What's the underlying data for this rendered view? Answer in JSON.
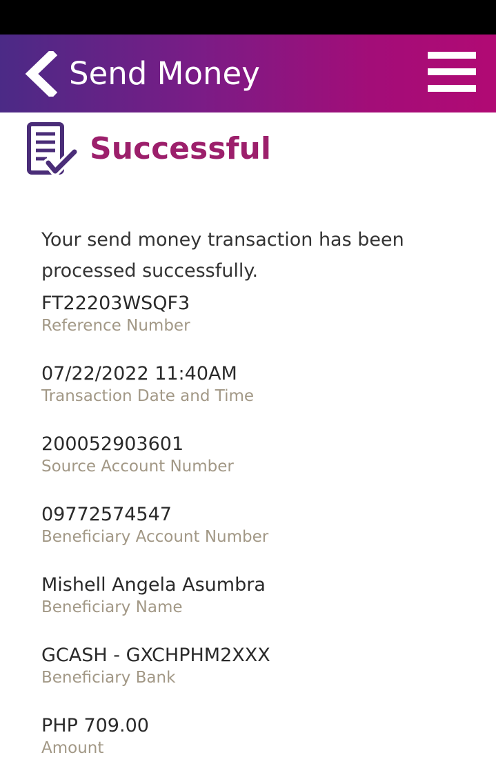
{
  "header": {
    "title": "Send Money",
    "back_icon": "chevron-left-icon",
    "menu_icon": "hamburger-menu-icon",
    "gradient": [
      "#4b2a86",
      "#b10a74"
    ]
  },
  "status": {
    "icon": "receipt-check-icon",
    "title": "Successful",
    "title_color": "#9c1f6b",
    "message": "Your send money transaction has been processed successfully."
  },
  "details": [
    {
      "value": "FT22203WSQF3",
      "label": "Reference Number"
    },
    {
      "value": "07/22/2022 11:40AM",
      "label": "Transaction Date and Time"
    },
    {
      "value": "200052903601",
      "label": "Source Account Number"
    },
    {
      "value": "09772574547",
      "label": "Beneficiary Account Number"
    },
    {
      "value": "Mishell Angela Asumbra",
      "label": "Beneficiary Name"
    },
    {
      "value": "GCASH - GXCHPHM2XXX",
      "label": "Beneficiary Bank"
    },
    {
      "value": "PHP 709.00",
      "label": "Amount"
    }
  ],
  "colors": {
    "label": "#a29886",
    "value": "#2a2a2a",
    "icon": "#4a2d78"
  }
}
